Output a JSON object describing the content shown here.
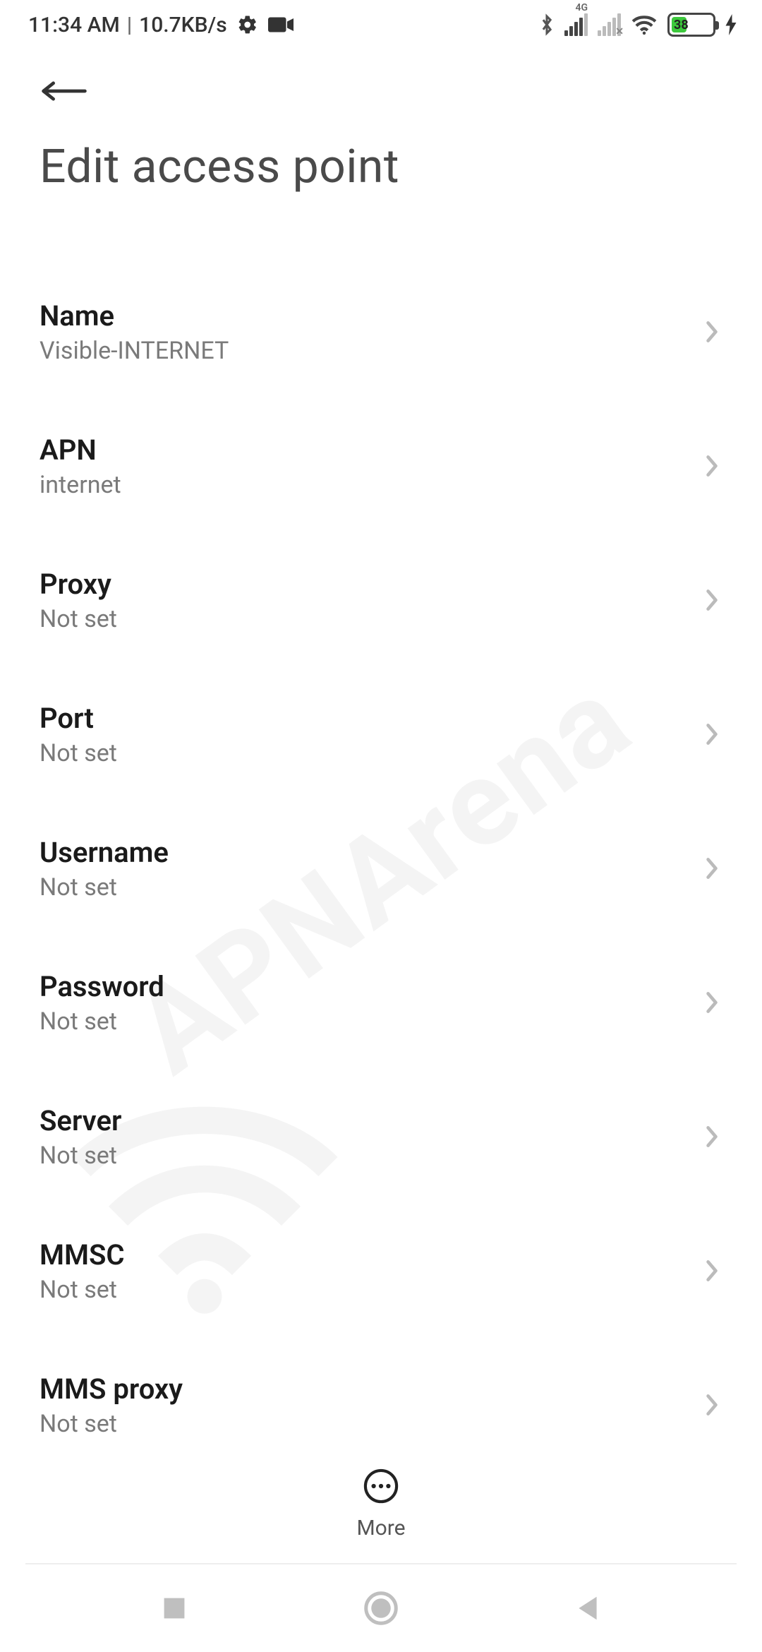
{
  "status_bar": {
    "time": "11:34 AM",
    "net_speed": "10.7KB/s",
    "network_type": "4G",
    "battery_percent": "38",
    "battery_fill_pct": 38
  },
  "header": {
    "title": "Edit access point"
  },
  "settings": [
    {
      "label": "Name",
      "value": "Visible-INTERNET"
    },
    {
      "label": "APN",
      "value": "internet"
    },
    {
      "label": "Proxy",
      "value": "Not set"
    },
    {
      "label": "Port",
      "value": "Not set"
    },
    {
      "label": "Username",
      "value": "Not set"
    },
    {
      "label": "Password",
      "value": "Not set"
    },
    {
      "label": "Server",
      "value": "Not set"
    },
    {
      "label": "MMSC",
      "value": "Not set"
    },
    {
      "label": "MMS proxy",
      "value": "Not set"
    }
  ],
  "bottom": {
    "more_label": "More"
  },
  "watermark": {
    "text": "APNArena"
  }
}
